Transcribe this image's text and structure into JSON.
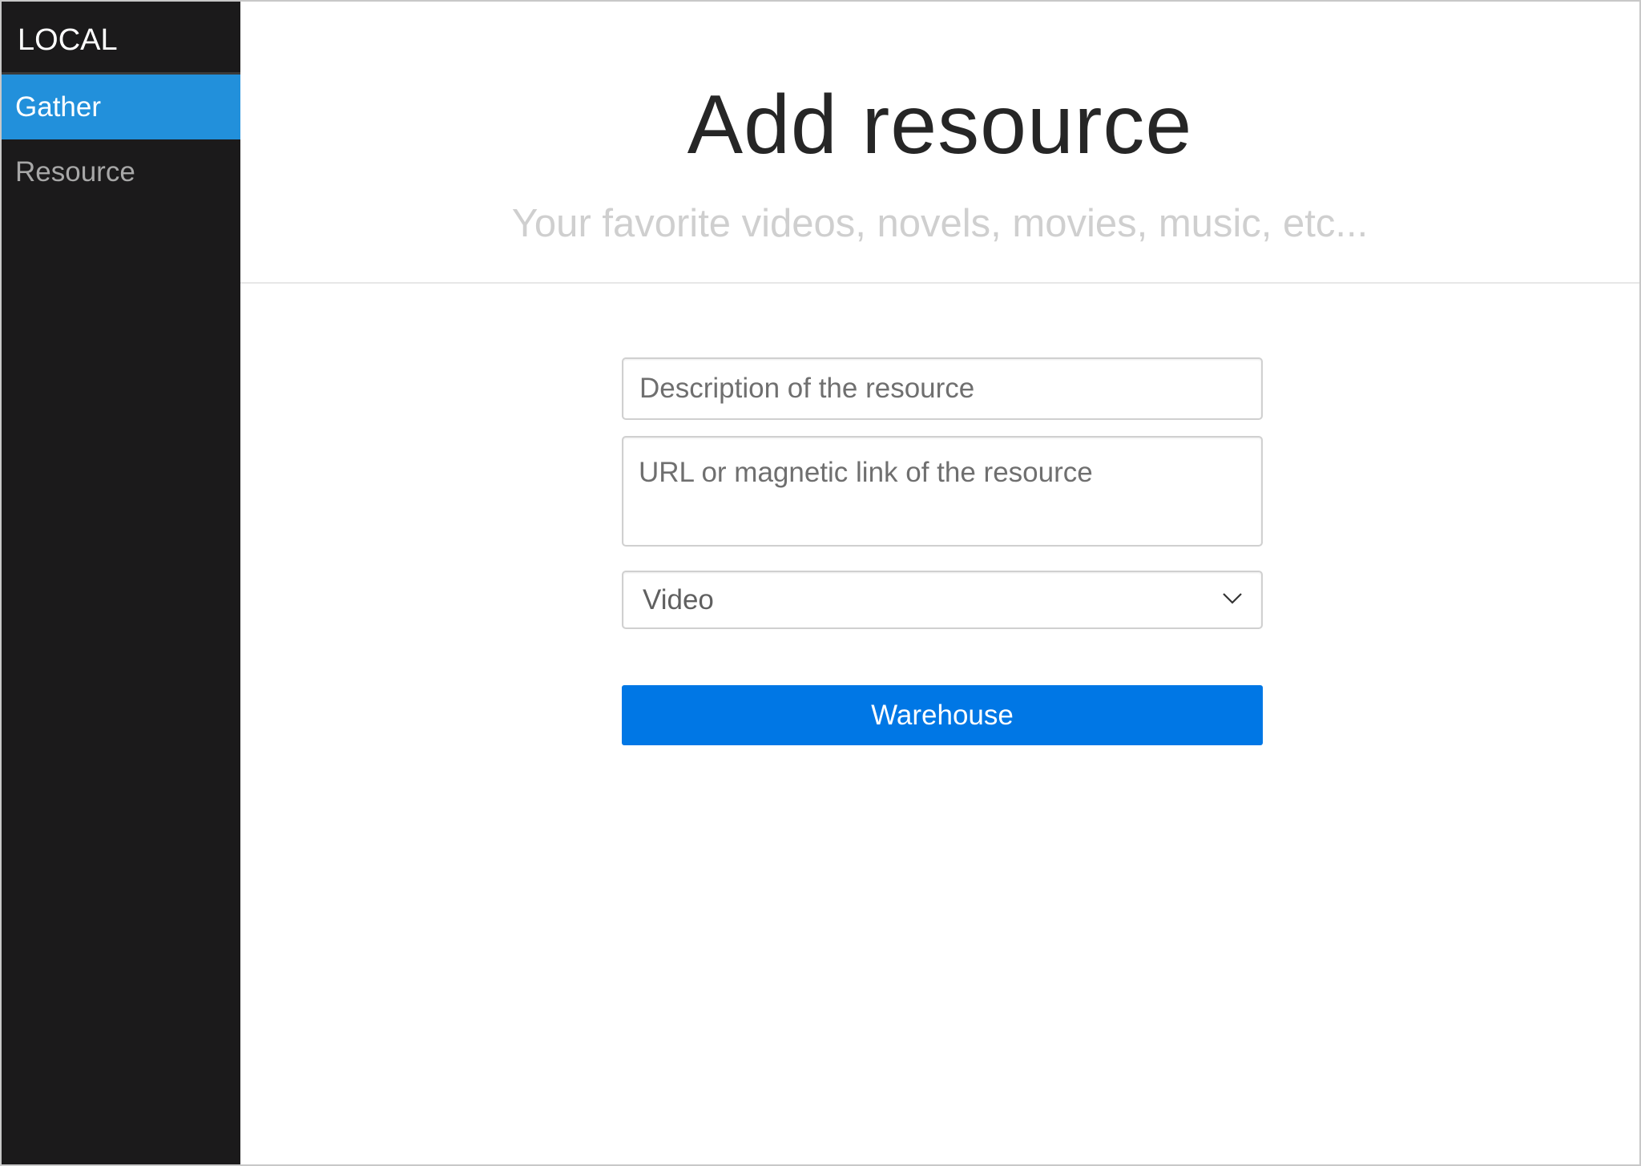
{
  "sidebar": {
    "brand": "LOCAL",
    "items": [
      {
        "label": "Gather",
        "active": true
      },
      {
        "label": "Resource",
        "active": false
      }
    ]
  },
  "header": {
    "title": "Add resource",
    "subtitle": "Your favorite videos, novels, movies, music, etc..."
  },
  "form": {
    "description_placeholder": "Description of the resource",
    "url_placeholder": "URL or magnetic link of the resource",
    "type_selected": "Video",
    "submit_label": "Warehouse"
  },
  "icons": {
    "select_arrow": "chevron-down-icon"
  },
  "colors": {
    "sidebar_bg": "#1b1a1b",
    "active_item": "#2290db",
    "submit_button": "#0077e5"
  }
}
